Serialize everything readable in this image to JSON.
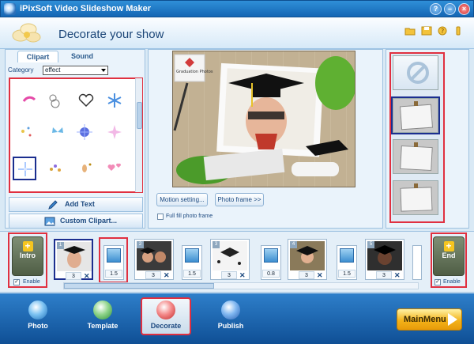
{
  "window": {
    "title": "iPixSoft Video Slideshow Maker"
  },
  "header": {
    "page_title": "Decorate your show"
  },
  "left_panel": {
    "tabs": [
      {
        "label": "Clipart"
      },
      {
        "label": "Sound"
      }
    ],
    "category_label": "Category",
    "category_value": "effect",
    "add_text_label": "Add Text",
    "custom_clipart_label": "Custom Clipart..."
  },
  "preview": {
    "stamp_text": "Graduation Photos"
  },
  "center_panel": {
    "motion_button": "Motion setting...",
    "frame_button": "Photo frame >>",
    "full_fill_label": "Full fill photo frame"
  },
  "timeline": {
    "intro": {
      "label": "Intro",
      "enable_label": "Enable"
    },
    "end": {
      "label": "End",
      "enable_label": "Enable"
    },
    "slides": [
      {
        "number": "1",
        "duration": "3"
      },
      {
        "number": "2",
        "duration": "3"
      },
      {
        "number": "3",
        "duration": "3"
      },
      {
        "number": "4",
        "duration": "3"
      },
      {
        "number": "5",
        "duration": "3"
      }
    ],
    "transitions": [
      {
        "duration": "1.5"
      },
      {
        "duration": "1.5"
      },
      {
        "duration": "0.8"
      },
      {
        "duration": "1.5"
      }
    ]
  },
  "bottom_nav": {
    "items": [
      {
        "label": "Photo"
      },
      {
        "label": "Template"
      },
      {
        "label": "Decorate"
      },
      {
        "label": "Publish"
      }
    ],
    "main_menu": "MainMenu"
  },
  "colors": {
    "accent": "#1466b4",
    "highlight": "#e03040",
    "selection": "#1b2e8f",
    "main_menu": "#f3b31a"
  }
}
